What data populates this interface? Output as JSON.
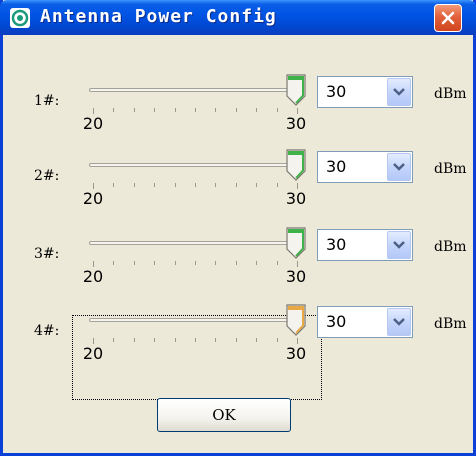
{
  "window": {
    "title": "Antenna Power Config",
    "app_icon": "app-logo-icon",
    "close_icon": "close-icon"
  },
  "sliders": [
    {
      "label": "1#:",
      "min_label": "20",
      "max_label": "30",
      "min": 20,
      "max": 30,
      "value": 30,
      "selected": "30",
      "unit": "dBm",
      "focused": false
    },
    {
      "label": "2#:",
      "min_label": "20",
      "max_label": "30",
      "min": 20,
      "max": 30,
      "value": 30,
      "selected": "30",
      "unit": "dBm",
      "focused": false
    },
    {
      "label": "3#:",
      "min_label": "20",
      "max_label": "30",
      "min": 20,
      "max": 30,
      "value": 30,
      "selected": "30",
      "unit": "dBm",
      "focused": false
    },
    {
      "label": "4#:",
      "min_label": "20",
      "max_label": "30",
      "min": 20,
      "max": 30,
      "value": 30,
      "selected": "30",
      "unit": "dBm",
      "focused": true
    }
  ],
  "buttons": {
    "ok_label": "OK"
  },
  "colors": {
    "thumb_normal": "#3fb24a",
    "thumb_focused": "#e9a846",
    "titlebar": "#0055e5",
    "dialog_bg": "#ECE9D8"
  }
}
